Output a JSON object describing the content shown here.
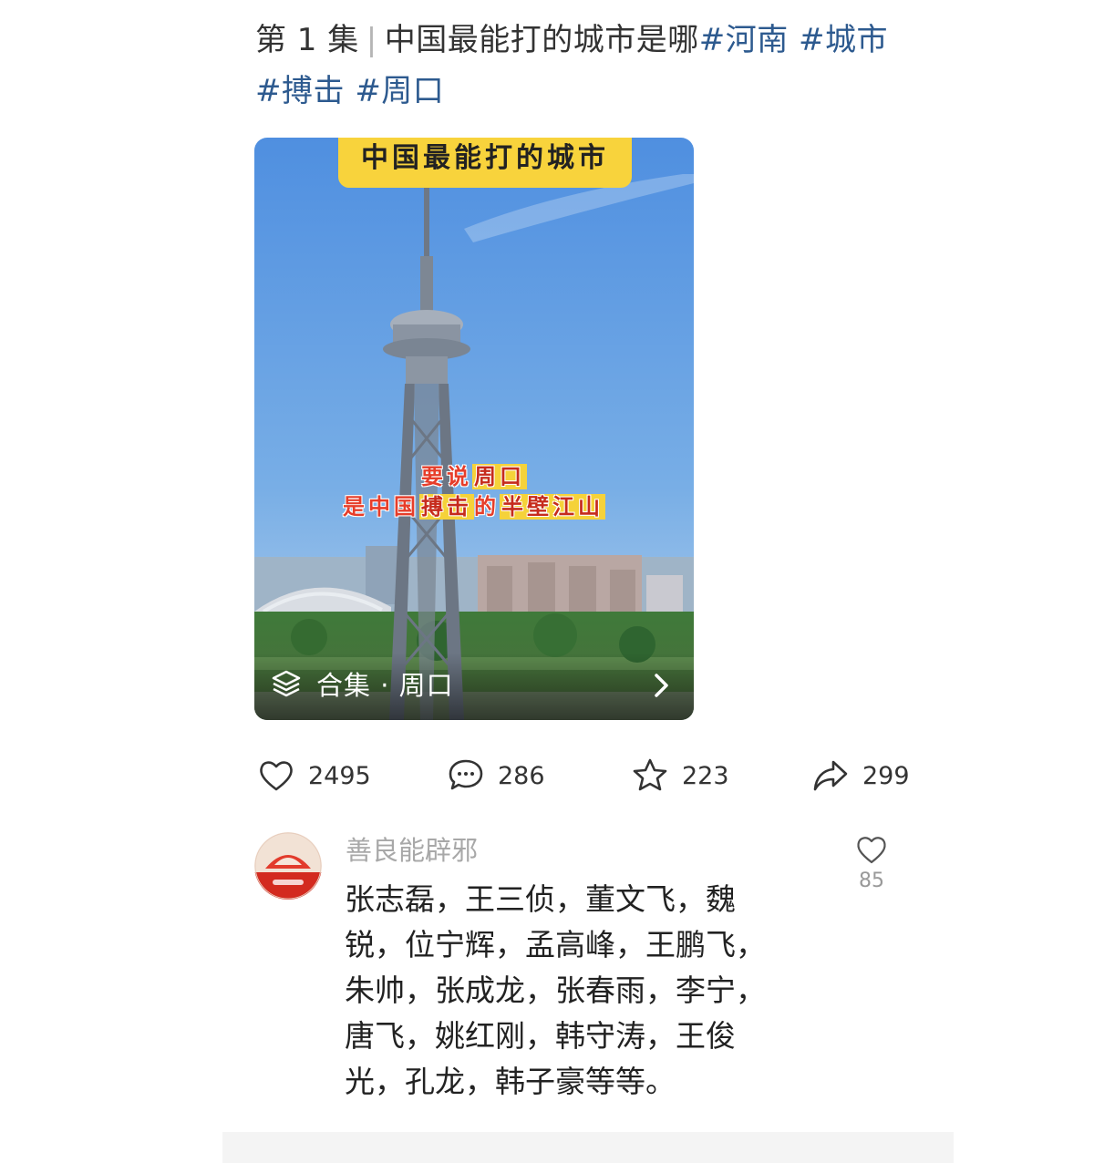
{
  "post": {
    "episode": "第 1 集",
    "separator": "|",
    "title_text": "中国最能打的城市是哪",
    "hashtags": [
      "#河南",
      "#城市",
      "#搏击",
      "#周口"
    ]
  },
  "video": {
    "banner_text": "中国最能打的城市",
    "caption_line1": [
      "要说",
      "周口"
    ],
    "caption_line2": [
      "是中国",
      "搏击",
      "的",
      "半壁江山"
    ],
    "collection_label": "合集 · 周口",
    "collection_icon": "layers-icon",
    "chevron_icon": "chevron-right-icon"
  },
  "actions": {
    "like": {
      "icon": "heart-icon",
      "count": "2495"
    },
    "comment": {
      "icon": "comment-bubble-icon",
      "count": "286"
    },
    "favorite": {
      "icon": "star-icon",
      "count": "223"
    },
    "share": {
      "icon": "share-arrow-icon",
      "count": "299"
    }
  },
  "comment": {
    "username": "善良能辟邪",
    "lines": [
      "张志磊，王三侦，董文飞，魏",
      "锐，位宁辉，孟高峰，王鹏飞，",
      "朱帅，张成龙，张春雨，李宁，",
      "唐飞，姚红刚，韩守涛，王俊",
      "光，孔龙，韩子豪等等。"
    ],
    "like_count": "85"
  },
  "colors": {
    "hashtag": "#2d5a8f",
    "banner": "#f8d33c",
    "caption_red": "#e63d2a",
    "username": "#a8a8a8"
  }
}
